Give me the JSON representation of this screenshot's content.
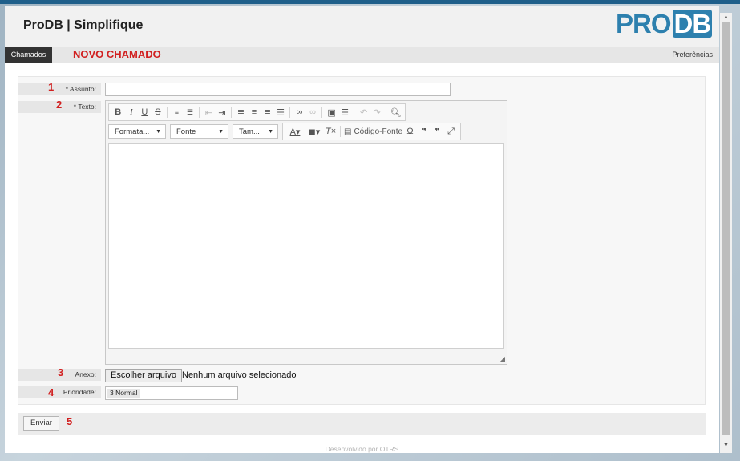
{
  "header": {
    "title": "ProDB | Simplifique",
    "logo_pro": "PRO",
    "logo_db": "DB"
  },
  "nav": {
    "tab_label": "Chamados",
    "page_title": "NOVO CHAMADO",
    "preferences_label": "Preferências"
  },
  "form": {
    "subject": {
      "step": "1",
      "label": "* Assunto:",
      "value": ""
    },
    "text": {
      "step": "2",
      "label": "* Texto:"
    },
    "attachment": {
      "step": "3",
      "label": "Anexo:",
      "button_label": "Escolher arquivo",
      "status": "Nenhum arquivo selecionado"
    },
    "priority": {
      "step": "4",
      "label": "Prioridade:",
      "value": "3 Normal"
    }
  },
  "editor": {
    "format_combo": "Formata...",
    "font_combo": "Fonte",
    "size_combo": "Tam...",
    "source_label": "Código-Fonte",
    "content": ""
  },
  "footer": {
    "submit_label": "Enviar",
    "submit_step": "5",
    "powered_by": "Desenvolvido por OTRS"
  },
  "colors": {
    "accent_red": "#d12020",
    "brand_blue": "#2d80ae",
    "nav_dark": "#333333"
  }
}
